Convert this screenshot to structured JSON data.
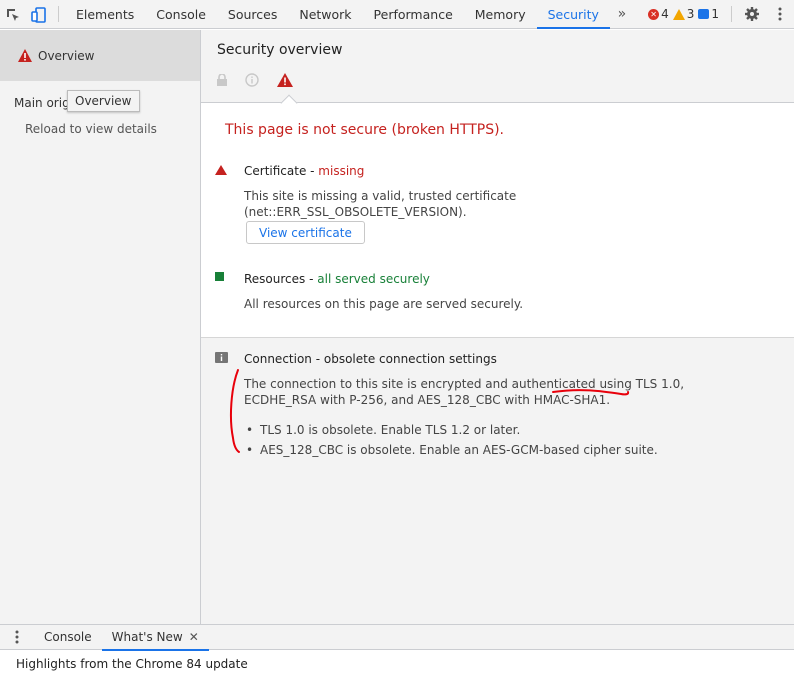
{
  "toolbar": {
    "tabs": [
      "Elements",
      "Console",
      "Sources",
      "Network",
      "Performance",
      "Memory",
      "Security"
    ],
    "active_tab": "Security",
    "error_count": "4",
    "warning_count": "3",
    "message_count": "1"
  },
  "sidebar": {
    "overview_label": "Overview",
    "main_origin_label": "Main origi",
    "tooltip": "Overview",
    "reload_text": "Reload to view details"
  },
  "main": {
    "title": "Security overview",
    "summary": "This page is not secure (broken HTTPS).",
    "certificate": {
      "title": "Certificate - ",
      "status": "missing",
      "desc_line1": "This site is missing a valid, trusted certificate",
      "desc_line2": "(net::ERR_SSL_OBSOLETE_VERSION).",
      "button": "View certificate"
    },
    "resources": {
      "title": "Resources - ",
      "status": "all served securely",
      "desc": "All resources on this page are served securely."
    },
    "connection": {
      "title": "Connection - obsolete connection settings",
      "desc_line1": "The connection to this site is encrypted and authenticated using TLS 1.0,",
      "desc_line2": "ECDHE_RSA with P-256, and AES_128_CBC with HMAC-SHA1.",
      "bullets": [
        "TLS 1.0 is obsolete. Enable TLS 1.2 or later.",
        "AES_128_CBC is obsolete. Enable an AES-GCM-based cipher suite."
      ]
    }
  },
  "drawer": {
    "tabs": [
      "Console",
      "What's New"
    ],
    "active_tab": "What's New",
    "body": "Highlights from the Chrome 84 update"
  },
  "colors": {
    "accent": "#1a73e8",
    "insecure": "#c5221f",
    "secure": "#188038",
    "annotation": "#e8000b"
  }
}
